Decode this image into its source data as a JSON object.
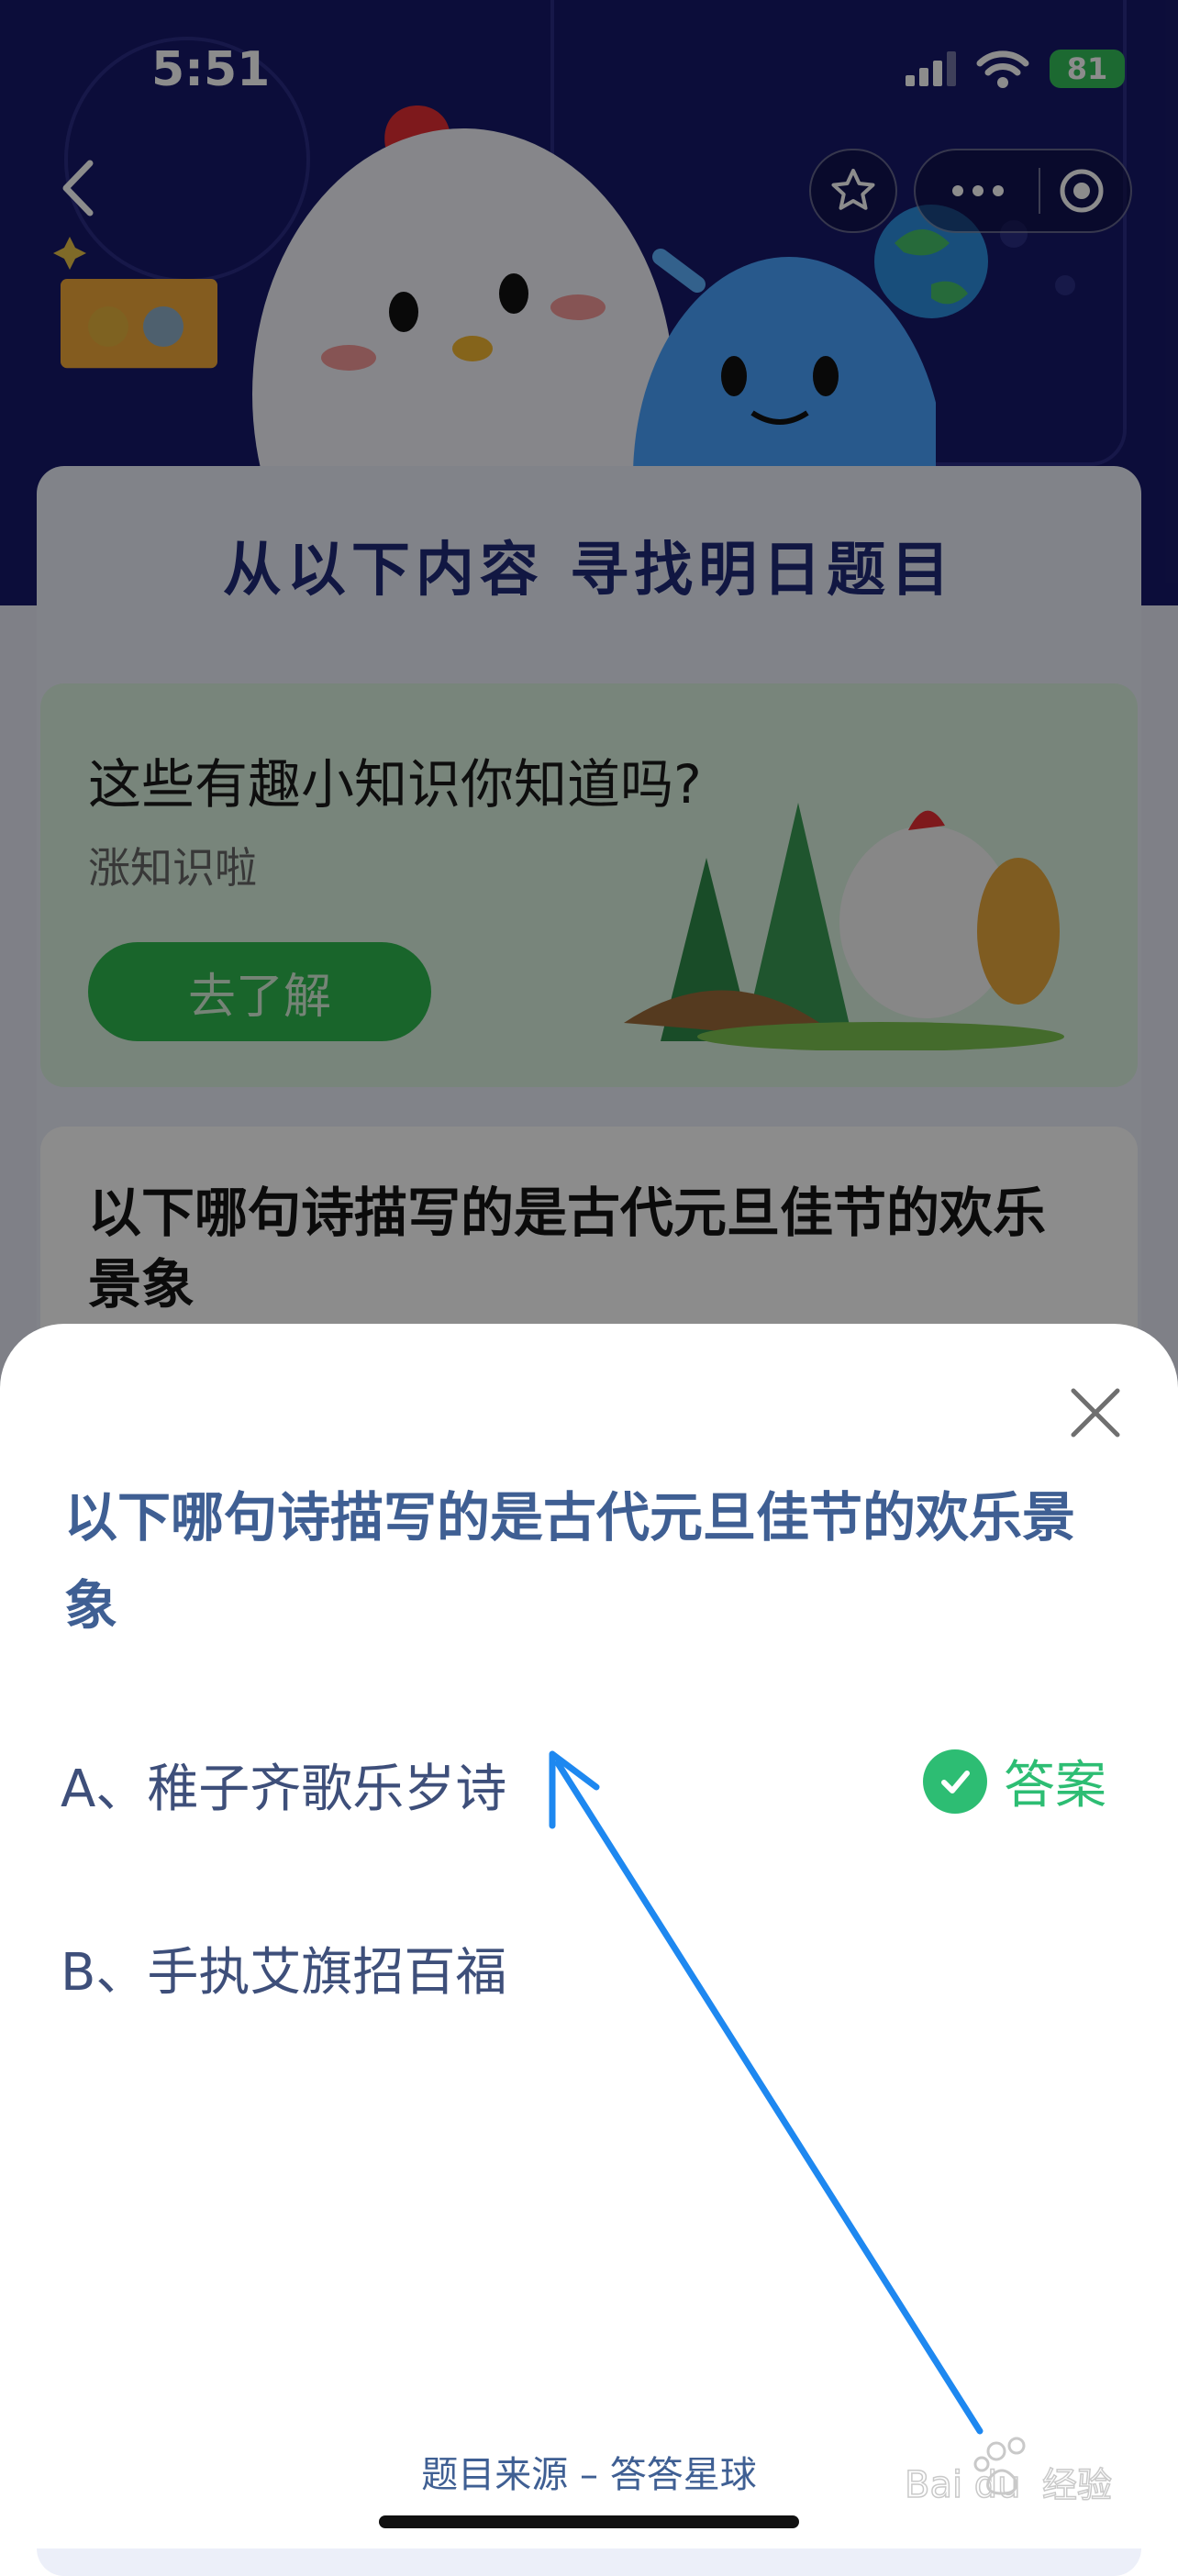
{
  "status_bar": {
    "time": "5:51",
    "battery": "81"
  },
  "background": {
    "heading": "从以下内容 寻找明日题目",
    "promo": {
      "title": "这些有趣小知识你知道吗?",
      "subtitle": "涨知识啦",
      "button": "去了解"
    },
    "question_card": "以下哪句诗描写的是古代元旦佳节的欢乐景象"
  },
  "sheet": {
    "question": "以下哪句诗描写的是古代元旦佳节的欢乐景象",
    "options": [
      {
        "label": "A、稚子齐歌乐岁诗",
        "correct": true
      },
      {
        "label": "B、手执艾旗招百福",
        "correct": false
      }
    ],
    "answer_label": "答案",
    "source": "题目来源 – 答答星球"
  },
  "watermark": "Baidu经验",
  "colors": {
    "accent": "#3f5f93",
    "correct": "#2dbd73",
    "arrow": "#1e88f0"
  }
}
